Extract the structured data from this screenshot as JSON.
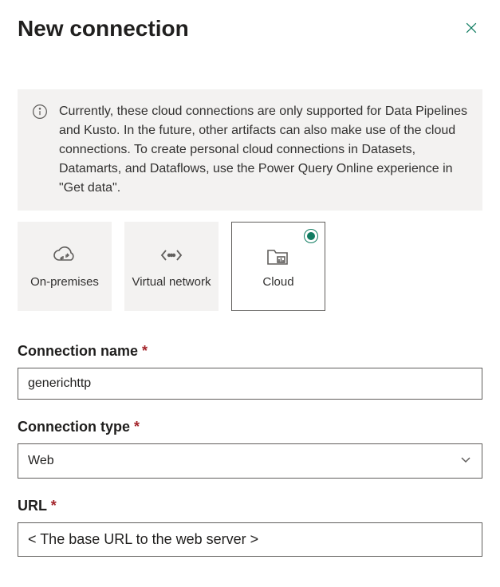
{
  "header": {
    "title": "New connection"
  },
  "info": {
    "text": "Currently, these cloud connections are only supported for Data Pipelines and Kusto. In the future, other artifacts can also make use of the cloud connections. To create personal cloud connections in Datasets, Datamarts, and Dataflows, use the Power Query Online experience in \"Get data\"."
  },
  "tiles": {
    "onprem": "On-premises",
    "vnet": "Virtual network",
    "cloud": "Cloud"
  },
  "fields": {
    "connectionName": {
      "label": "Connection name",
      "value": "generichttp"
    },
    "connectionType": {
      "label": "Connection type",
      "value": "Web"
    },
    "url": {
      "label": "URL",
      "value": "< The base URL to the web server >"
    }
  }
}
